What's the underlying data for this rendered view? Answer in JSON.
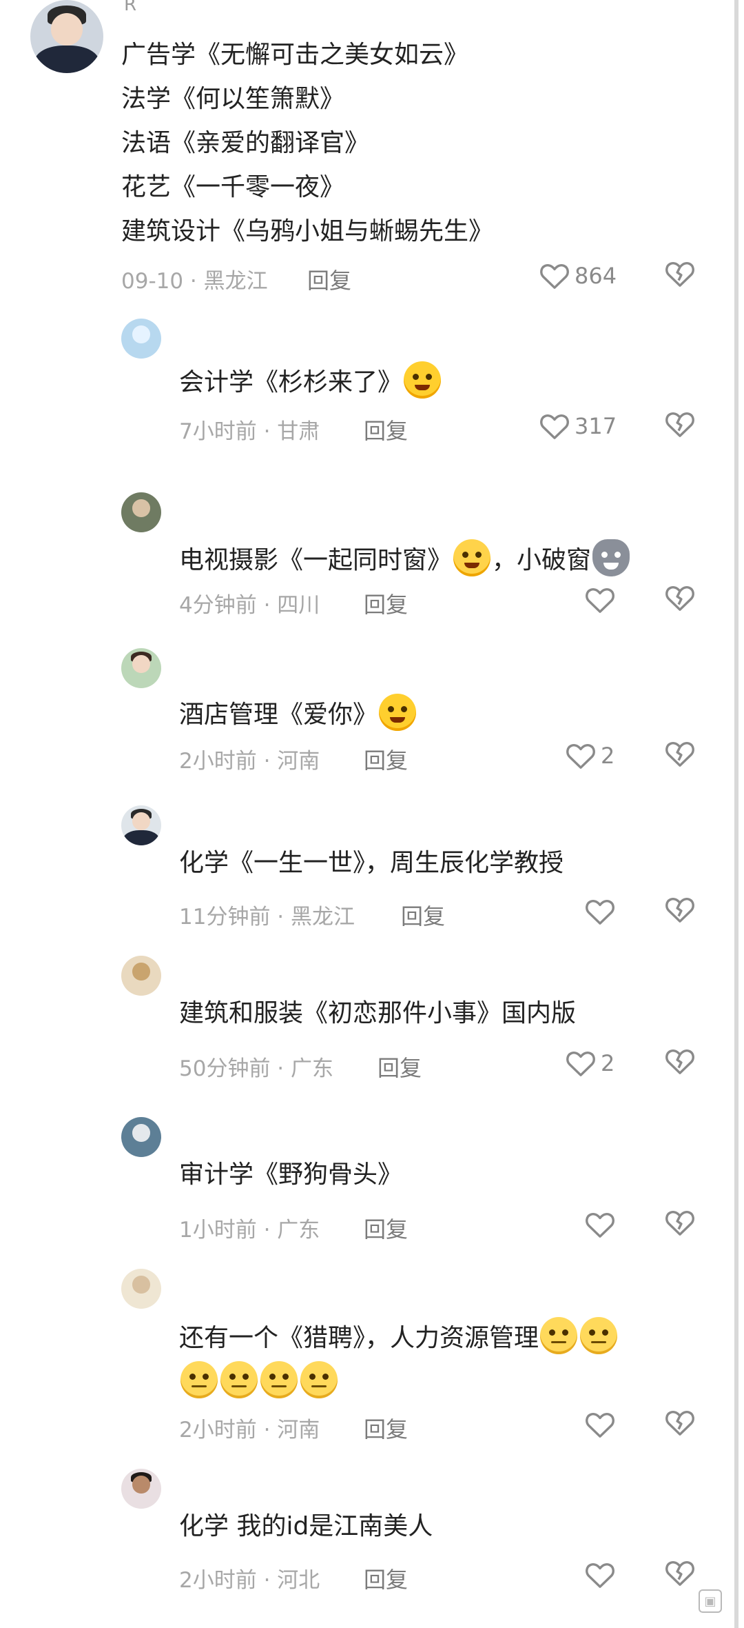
{
  "comments": [
    {
      "nick": "R",
      "lines": [
        "广告学《无懈可击之美女如云》",
        "法学《何以笙箫默》",
        "法语《亲爱的翻译官》",
        "花艺《一千零一夜》",
        "建筑设计《乌鸦小姐与蜥蜴先生》"
      ],
      "meta": "09-10 · 黑龙江",
      "reply": "回复",
      "likes": "864"
    },
    {
      "lines": [
        "会计学《杉杉来了》"
      ],
      "emoji": "wink-emoji",
      "meta": "7小时前 · 甘肃",
      "reply": "回复",
      "likes": "317"
    },
    {
      "lines": [
        "电视摄影《一起同时窗》",
        "，小破窗"
      ],
      "emoji": "thinking-emoji",
      "emoji2": "cat-emoji",
      "meta": "4分钟前 · 四川",
      "reply": "回复",
      "likes": ""
    },
    {
      "lines": [
        "酒店管理《爱你》"
      ],
      "emoji": "wink-emoji",
      "meta": "2小时前 · 河南",
      "reply": "回复",
      "likes": "2"
    },
    {
      "lines": [
        "化学《一生一世》，周生辰化学教授"
      ],
      "meta": "11分钟前 · 黑龙江",
      "reply": "回复",
      "likes": ""
    },
    {
      "lines": [
        "建筑和服装《初恋那件小事》国内版"
      ],
      "meta": "50分钟前 · 广东",
      "reply": "回复",
      "likes": "2"
    },
    {
      "lines": [
        "审计学《野狗骨头》"
      ],
      "meta": "1小时前 · 广东",
      "reply": "回复",
      "likes": ""
    },
    {
      "lines": [
        "还有一个《猎聘》，人力资源管理"
      ],
      "emoji": "grumpy-emoji",
      "meta": "2小时前 · 河南",
      "reply": "回复",
      "likes": ""
    },
    {
      "lines": [
        "化学 我的id是江南美人"
      ],
      "meta": "2小时前 · 河北",
      "reply": "回复",
      "likes": ""
    }
  ],
  "colors": {
    "text": "#222222",
    "meta": "#a7a7a7",
    "icon": "#8a8a8a"
  },
  "icons": {
    "like": "heart-outline-icon",
    "dislike": "broken-heart-icon"
  }
}
